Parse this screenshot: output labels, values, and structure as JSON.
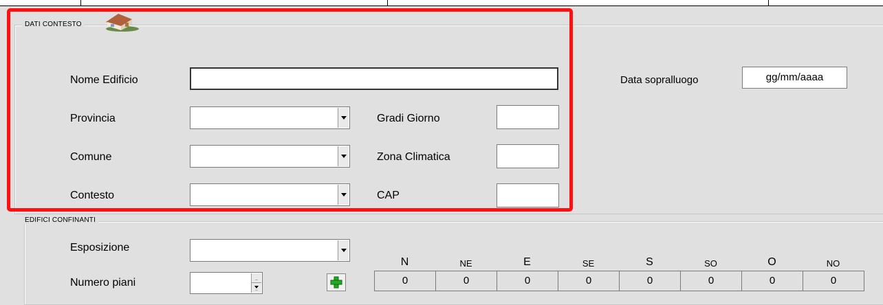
{
  "dati_contesto": {
    "legend": "DATI CONTESTO",
    "icon": "house-icon",
    "nome_edificio_label": "Nome Edificio",
    "nome_edificio_value": "",
    "provincia_label": "Provincia",
    "provincia_value": "",
    "comune_label": "Comune",
    "comune_value": "",
    "contesto_label": "Contesto",
    "contesto_value": "",
    "gradi_giorno_label": "Gradi Giorno",
    "gradi_giorno_value": "",
    "zona_climatica_label": "Zona Climatica",
    "zona_climatica_value": "",
    "cap_label": "CAP",
    "cap_value": "",
    "data_sopralluogo_label": "Data sopralluogo",
    "data_sopralluogo_value": "gg/mm/aaaa"
  },
  "edifici_confinanti": {
    "legend": "EDIFICI CONFINANTI",
    "esposizione_label": "Esposizione",
    "esposizione_value": "",
    "numero_piani_label": "Numero piani",
    "numero_piani_value": "",
    "add_icon": "plus-icon",
    "directions": [
      {
        "label": "N",
        "value": "0"
      },
      {
        "label": "NE",
        "value": "0"
      },
      {
        "label": "E",
        "value": "0"
      },
      {
        "label": "SE",
        "value": "0"
      },
      {
        "label": "S",
        "value": "0"
      },
      {
        "label": "SO",
        "value": "0"
      },
      {
        "label": "O",
        "value": "0"
      },
      {
        "label": "NO",
        "value": "0"
      }
    ]
  },
  "colors": {
    "highlight": "#ff1010",
    "background": "#e0e0e0",
    "add_icon": "#22aa22"
  }
}
